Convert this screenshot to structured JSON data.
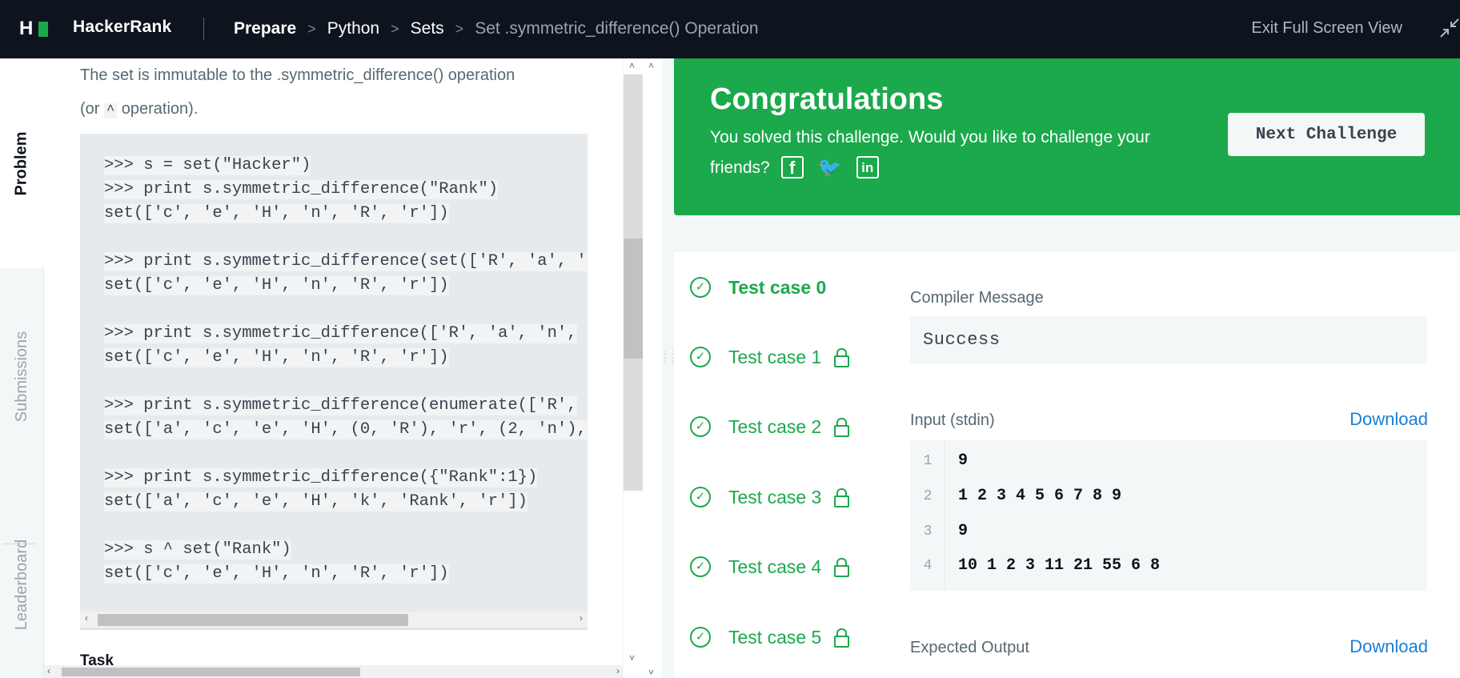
{
  "header": {
    "brand": "HackerRank",
    "breadcrumbs": [
      "Prepare",
      "Python",
      "Sets",
      "Set .symmetric_difference() Operation"
    ],
    "exit_label": "Exit Full Screen View"
  },
  "tabs": {
    "problem": "Problem",
    "submissions": "Submissions",
    "leaderboard": "Leaderboard"
  },
  "problem": {
    "para_1": "The set is immutable to the .symmetric_difference() operation",
    "para_2_pre": "(or ",
    "para_2_code": "^",
    "para_2_post": " operation).",
    "code_lines": [
      ">>> s = set(\"Hacker\")",
      ">>> print s.symmetric_difference(\"Rank\")",
      "set(['c', 'e', 'H', 'n', 'R', 'r'])",
      ">>> print s.symmetric_difference(set(['R', 'a', '",
      "set(['c', 'e', 'H', 'n', 'R', 'r'])",
      ">>> print s.symmetric_difference(['R', 'a', 'n',",
      "set(['c', 'e', 'H', 'n', 'R', 'r'])",
      ">>> print s.symmetric_difference(enumerate(['R',",
      "set(['a', 'c', 'e', 'H', (0, 'R'), 'r', (2, 'n'),",
      ">>> print s.symmetric_difference({\"Rank\":1})",
      "set(['a', 'c', 'e', 'H', 'k', 'Rank', 'r'])",
      ">>> s ^ set(\"Rank\")",
      "set(['c', 'e', 'H', 'n', 'R', 'r'])"
    ],
    "task_heading": "Task"
  },
  "banner": {
    "title": "Congratulations",
    "message": "You solved this challenge. Would you like to challenge your friends?",
    "next_label": "Next Challenge",
    "bg_color": "#1ba94c"
  },
  "results": {
    "test_cases": [
      "Test case 0",
      "Test case 1",
      "Test case 2",
      "Test case 3",
      "Test case 4",
      "Test case 5"
    ],
    "compiler_label": "Compiler Message",
    "compiler_value": "Success",
    "input_label": "Input (stdin)",
    "download_label": "Download",
    "input_lines": [
      {
        "n": "1",
        "text": "9"
      },
      {
        "n": "2",
        "text": "1 2 3 4 5 6 7 8 9"
      },
      {
        "n": "3",
        "text": "9"
      },
      {
        "n": "4",
        "text": "10 1 2 3 11 21 55 6 8"
      }
    ],
    "expected_label": "Expected Output"
  }
}
